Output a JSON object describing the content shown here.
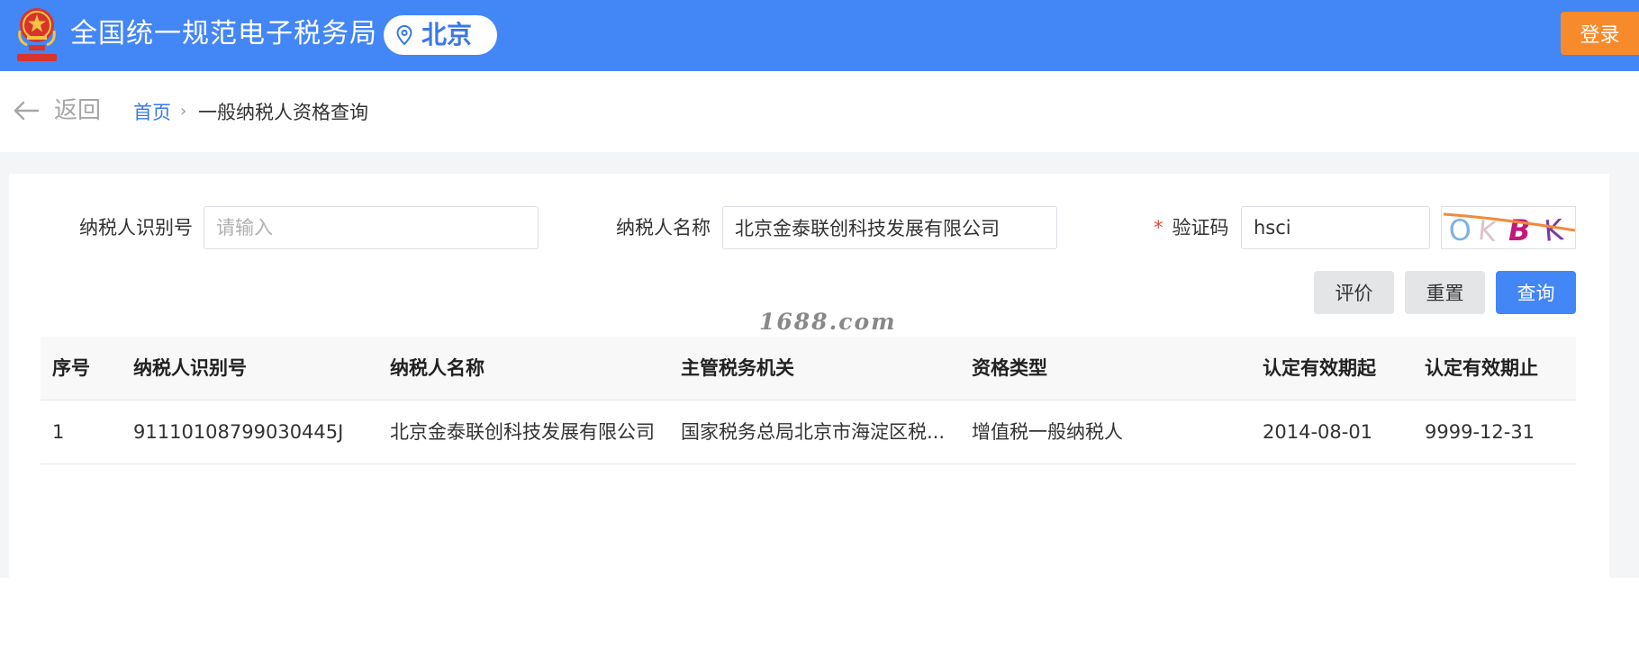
{
  "header": {
    "title": "全国统一规范电子税务局",
    "region": "北京",
    "login_label": "登录",
    "emblem_icon": "national-tax-emblem-icon",
    "location_icon": "location-pin-icon"
  },
  "breadcrumb": {
    "back_label": "返回",
    "home_label": "首页",
    "separator": "›",
    "current_label": "一般纳税人资格查询"
  },
  "form": {
    "taxpayer_id_label": "纳税人识别号",
    "taxpayer_id_value": "",
    "taxpayer_id_placeholder": "请输入",
    "taxpayer_name_label": "纳税人名称",
    "taxpayer_name_value": "北京金泰联创科技发展有限公司",
    "captcha_required_mark": "*",
    "captcha_label": "验证码",
    "captcha_value": "hsci",
    "captcha_image_chars": [
      "O",
      "K",
      "B",
      "K"
    ]
  },
  "buttons": {
    "evaluate": "评价",
    "reset": "重置",
    "query": "查询"
  },
  "watermark": "1688.com",
  "table": {
    "columns": [
      "序号",
      "纳税人识别号",
      "纳税人名称",
      "主管税务机关",
      "资格类型",
      "认定有效期起",
      "认定有效期止"
    ],
    "rows": [
      [
        "1",
        "91110108799030445J",
        "北京金泰联创科技发展有限公司",
        "国家税务总局北京市海淀区税...",
        "增值税一般纳税人",
        "2014-08-01",
        "9999-12-31"
      ]
    ]
  },
  "colors": {
    "header_bg": "#4386f5",
    "login_bg": "#f78a2a",
    "link": "#3a78e6",
    "required": "#e2483f"
  }
}
